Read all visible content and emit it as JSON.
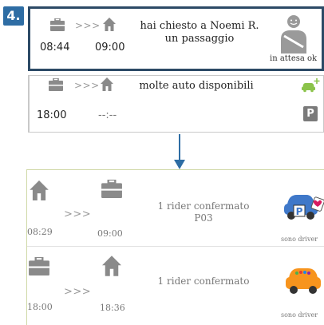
{
  "step": {
    "number": "4."
  },
  "top_request": {
    "from_icon": "briefcase-icon",
    "arrows": ">>>",
    "to_icon": "home-icon",
    "depart_time": "08:44",
    "arrive_time": "09:00",
    "message_line1": "hai chiesto a  Noemi R.",
    "message_line2": "un passaggio",
    "status_icon": "passenger-waiting-icon",
    "status_label": "in attesa ok"
  },
  "second_request": {
    "from_icon": "briefcase-icon",
    "arrows": ">>>",
    "to_icon": "home-icon",
    "message": "molte auto disponibili",
    "depart_time": "18:00",
    "arrive_time": "--:--",
    "add_car_icon": "add-car-icon",
    "parking_icon": "parking-icon",
    "parking_letter": "P"
  },
  "flow_arrow": {
    "icon": "down-arrow-icon"
  },
  "rides": [
    {
      "from_icon": "home-icon",
      "arrows": ">>>",
      "to_icon": "briefcase-icon",
      "depart_time": "08:29",
      "arrive_time": "09:00",
      "message_line1": "1 rider confermato",
      "message_line2": "P03",
      "car_icon": "blue-car-parking-heart-icon",
      "parking_letter": "P",
      "driver_label": "sono driver"
    },
    {
      "from_icon": "briefcase-icon",
      "arrows": ">>>",
      "to_icon": "home-icon",
      "depart_time": "18:00",
      "arrive_time": "18:36",
      "message_line1": "1 rider confermato",
      "car_icon": "orange-car-icon",
      "driver_label": "sono driver"
    }
  ],
  "colors": {
    "badge": "#2e6da4",
    "top_card_border": "#2c4a66",
    "icon_gray": "#8a8a8a",
    "add_car_green": "#8bc34a",
    "flow_arrow": "#2e6da4",
    "blue_car": "#3f78c9",
    "orange_car": "#f7941d",
    "heart": "#d81b60"
  }
}
